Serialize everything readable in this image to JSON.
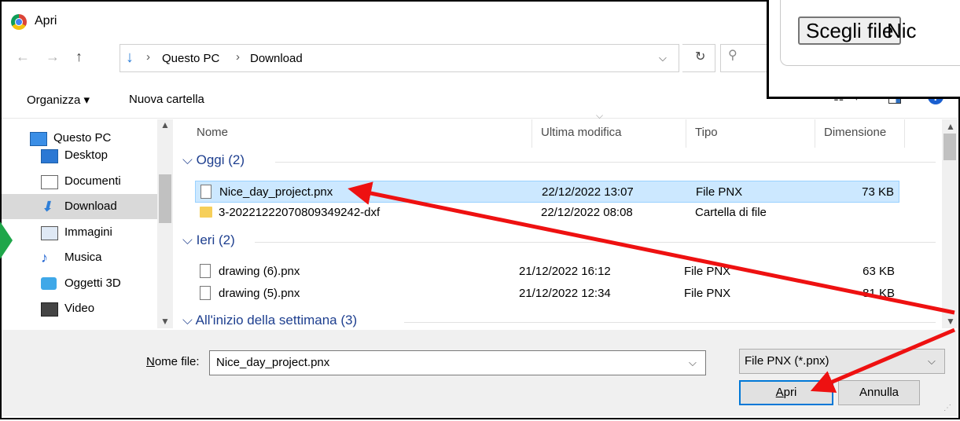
{
  "dialog": {
    "title": "Apri"
  },
  "nav": {
    "back_icon": "←",
    "forward_icon": "→",
    "up_icon": "↑",
    "breadcrumb": [
      "Questo PC",
      "Download"
    ],
    "separator": "›",
    "dropdown_icon": "⌵",
    "refresh_icon": "↻",
    "search_icon": "⚲"
  },
  "toolbar": {
    "organize_label": "Organizza ▾",
    "new_folder_label": "Nuova cartella",
    "view_icon": "☷ ▾",
    "help_icon": "?"
  },
  "overlay": {
    "choose_file_label": "Scegli file",
    "file_name_preview": "Nic"
  },
  "sidebar": {
    "items": [
      {
        "label": "Questo PC",
        "icon": "computer-icon"
      },
      {
        "label": "Desktop",
        "icon": "desktop-icon"
      },
      {
        "label": "Documenti",
        "icon": "documents-icon"
      },
      {
        "label": "Download",
        "icon": "download-icon",
        "selected": true
      },
      {
        "label": "Immagini",
        "icon": "pictures-icon"
      },
      {
        "label": "Musica",
        "icon": "music-icon"
      },
      {
        "label": "Oggetti 3D",
        "icon": "objects-3d-icon"
      },
      {
        "label": "Video",
        "icon": "video-icon"
      }
    ]
  },
  "columns": [
    "Nome",
    "Ultima modifica",
    "Tipo",
    "Dimensione"
  ],
  "groups": [
    {
      "label": "Oggi (2)",
      "files": [
        {
          "name": "Nice_day_project.pnx",
          "modified": "22/12/2022 13:07",
          "type": "File PNX",
          "size": "73 KB",
          "selected": true
        },
        {
          "name": "3-20221222070809349242-dxf",
          "modified": "22/12/2022 08:08",
          "type": "Cartella di file",
          "size": ""
        }
      ]
    },
    {
      "label": "Ieri (2)",
      "files": [
        {
          "name": "drawing (6).pnx",
          "modified": "21/12/2022 16:12",
          "type": "File PNX",
          "size": "63 KB"
        },
        {
          "name": "drawing (5).pnx",
          "modified": "21/12/2022 12:34",
          "type": "File PNX",
          "size": "81 KB"
        }
      ]
    },
    {
      "label": "All'inizio della settimana (3)",
      "files": []
    }
  ],
  "bottom": {
    "filename_label": "Nome file:",
    "filename_value": "Nice_day_project.pnx",
    "filetype_value": "File PNX (*.pnx)",
    "open_label": "Apri",
    "cancel_label": "Annulla"
  },
  "colors": {
    "selection_bg": "#cce8ff",
    "group_header": "#1e3f8f",
    "annotation_arrow": "#ee1111",
    "green_marker": "#1fa64a",
    "primary_button_border": "#0078d7"
  }
}
